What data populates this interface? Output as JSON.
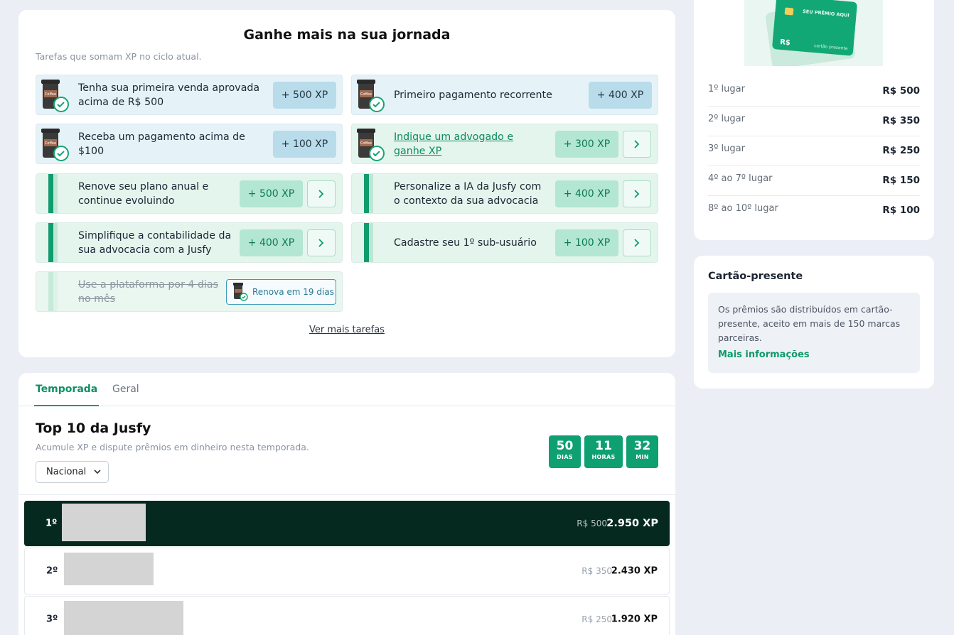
{
  "journey": {
    "title": "Ganhe mais na sua jornada",
    "subtitle": "Tarefas que somam XP no ciclo atual.",
    "tasks": [
      {
        "text": "Tenha sua primeira venda aprovada acima de R$ 500",
        "xp": "+ 500 XP"
      },
      {
        "text": "Primeiro pagamento recorrente",
        "xp": "+ 400 XP"
      },
      {
        "text": "Receba um pagamento acima de $100",
        "xp": "+ 100 XP"
      },
      {
        "text": "Indique um advogado e ganhe XP",
        "xp": "+ 300 XP"
      },
      {
        "text": "Renove seu plano anual e continue evoluindo",
        "xp": "+ 500 XP"
      },
      {
        "text": "Personalize a IA da Jusfy com o contexto da sua advocacia",
        "xp": "+ 400 XP"
      },
      {
        "text": "Simplifique a contabilidade da sua advocacia com a Jusfy",
        "xp": "+ 400 XP"
      },
      {
        "text": "Cadastre seu 1º sub-usuário",
        "xp": "+ 100 XP"
      },
      {
        "text": "Use a plataforma por 4 dias no mês",
        "renew": "Renova em 19 dias"
      }
    ],
    "see_more": "Ver mais tarefas",
    "coffee_label": "Coffee"
  },
  "ranking": {
    "tabs": [
      "Temporada",
      "Geral"
    ],
    "title": "Top 10 da Jusfy",
    "subtitle": "Acumule XP e dispute prêmios em dinheiro nesta temporada.",
    "scope_select": "Nacional",
    "timer": [
      {
        "value": "50",
        "label": "DIAS"
      },
      {
        "value": "11",
        "label": "HORAS"
      },
      {
        "value": "32",
        "label": "MIN"
      }
    ],
    "rows": [
      {
        "position": "1º",
        "prize": "R$ 500",
        "xp": "2.950 XP"
      },
      {
        "position": "2º",
        "prize": "R$ 350",
        "xp": "2.430 XP"
      },
      {
        "position": "3º",
        "prize": "R$ 250",
        "xp": "1.920 XP"
      }
    ]
  },
  "prizes": {
    "card_image": {
      "header": "SEU PRÊMIO AQUI",
      "currency": "R$",
      "footer": "cartão presente"
    },
    "list": [
      {
        "place": "1º lugar",
        "value": "R$ 500"
      },
      {
        "place": "2º lugar",
        "value": "R$ 350"
      },
      {
        "place": "3º lugar",
        "value": "R$ 250"
      },
      {
        "place": "4º ao 7º lugar",
        "value": "R$ 150"
      },
      {
        "place": "8º ao 10º lugar",
        "value": "R$ 100"
      }
    ]
  },
  "giftcard": {
    "title": "Cartão-presente",
    "text": "Os prêmios são distribuídos em cartão-presente, aceito em mais de 150 marcas parceiras.",
    "link": "Mais informações"
  },
  "colors": {
    "accent": "#0fa071",
    "dark": "#06291f",
    "blue_task": "#e5f2f8",
    "green_task": "#e4f5ee"
  },
  "icons": [
    "coffee-cup-badge-icon",
    "chevron-right-icon",
    "chevron-down-icon"
  ]
}
